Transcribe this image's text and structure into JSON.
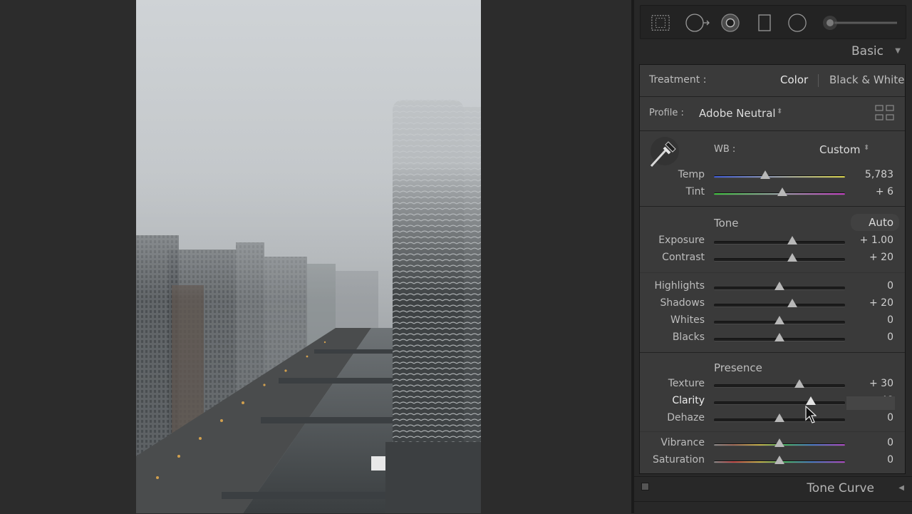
{
  "panel": {
    "title": "Basic",
    "treatment": {
      "label": "Treatment :",
      "options": [
        "Color",
        "Black & White"
      ],
      "selected": "Color"
    },
    "profile": {
      "label": "Profile :",
      "value": "Adobe Neutral"
    },
    "wb": {
      "label": "WB :",
      "value": "Custom",
      "sliders": [
        {
          "id": "temp",
          "label": "Temp",
          "value": "5,783",
          "level": 0.39
        },
        {
          "id": "tint",
          "label": "Tint",
          "value": "+ 6",
          "level": 0.52
        }
      ]
    },
    "tone": {
      "label": "Tone",
      "auto_label": "Auto",
      "sliders": [
        {
          "id": "exposure",
          "label": "Exposure",
          "value": "+ 1.00",
          "level": 0.6
        },
        {
          "id": "contrast",
          "label": "Contrast",
          "value": "+ 20",
          "level": 0.6
        },
        {
          "id": "highlights",
          "label": "Highlights",
          "value": "0",
          "level": 0.5
        },
        {
          "id": "shadows",
          "label": "Shadows",
          "value": "+ 20",
          "level": 0.6
        },
        {
          "id": "whites",
          "label": "Whites",
          "value": "0",
          "level": 0.5
        },
        {
          "id": "blacks",
          "label": "Blacks",
          "value": "0",
          "level": 0.5
        }
      ]
    },
    "presence": {
      "label": "Presence",
      "sliders": [
        {
          "id": "texture",
          "label": "Texture",
          "value": "+ 30",
          "level": 0.65
        },
        {
          "id": "clarity",
          "label": "Clarity",
          "value": "+ 48",
          "level": 0.74,
          "active": true
        },
        {
          "id": "dehaze",
          "label": "Dehaze",
          "value": "0",
          "level": 0.5
        },
        {
          "id": "vibrance",
          "label": "Vibrance",
          "value": "0",
          "level": 0.5
        },
        {
          "id": "saturation",
          "label": "Saturation",
          "value": "0",
          "level": 0.5
        }
      ]
    }
  },
  "next_panel": {
    "title": "Tone Curve"
  },
  "tools": [
    "crop-overlay-icon",
    "spot-removal-icon",
    "red-eye-icon",
    "graduated-filter-icon",
    "radial-filter-icon",
    "adjustment-brush-icon"
  ],
  "colors": {
    "panel_bg": "#3a3a3a",
    "header_bg": "#282828",
    "canvas_bg": "#2c2c2c",
    "text": "#c8c8c8"
  }
}
